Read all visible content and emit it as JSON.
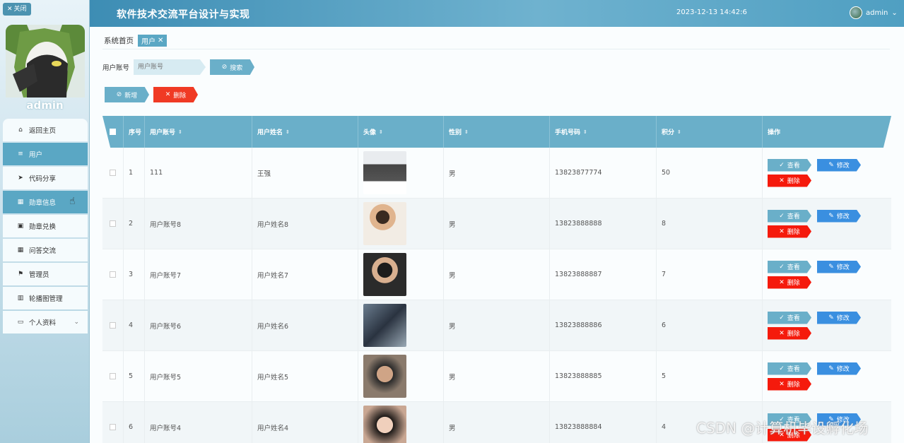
{
  "app": {
    "title": "软件技术交流平台设计与实现",
    "datetime": "2023-12-13 14:42:6",
    "user": "admin",
    "close_label": "关闭"
  },
  "sidebar": {
    "profile_name": "admin",
    "items": [
      {
        "label": "返回主页",
        "icon": "home-icon"
      },
      {
        "label": "用户",
        "icon": "list-icon"
      },
      {
        "label": "代码分享",
        "icon": "send-icon"
      },
      {
        "label": "勋章信息",
        "icon": "grid-icon"
      },
      {
        "label": "勋章兑换",
        "icon": "clipboard-icon"
      },
      {
        "label": "问答交流",
        "icon": "grid-icon"
      },
      {
        "label": "管理员",
        "icon": "flag-icon"
      },
      {
        "label": "轮播图管理",
        "icon": "chart-icon"
      },
      {
        "label": "个人资料",
        "icon": "window-icon"
      }
    ]
  },
  "breadcrumb": {
    "home": "系统首页",
    "current": "用户"
  },
  "search": {
    "label": "用户账号",
    "placeholder": "用户账号",
    "button": "搜索"
  },
  "actions": {
    "add": "新增",
    "delete": "删除"
  },
  "table": {
    "headers": [
      "序号",
      "用户账号",
      "用户姓名",
      "头像",
      "性别",
      "手机号码",
      "积分",
      "操作"
    ],
    "row_actions": {
      "view": "查看",
      "edit": "修改",
      "delete": "删除"
    },
    "rows": [
      {
        "index": "1",
        "account": "111",
        "name": "王强",
        "gender": "男",
        "phone": "13823877774",
        "points": "50"
      },
      {
        "index": "2",
        "account": "用户账号8",
        "name": "用户姓名8",
        "gender": "男",
        "phone": "13823888888",
        "points": "8"
      },
      {
        "index": "3",
        "account": "用户账号7",
        "name": "用户姓名7",
        "gender": "男",
        "phone": "13823888887",
        "points": "7"
      },
      {
        "index": "4",
        "account": "用户账号6",
        "name": "用户姓名6",
        "gender": "男",
        "phone": "13823888886",
        "points": "6"
      },
      {
        "index": "5",
        "account": "用户账号5",
        "name": "用户姓名5",
        "gender": "男",
        "phone": "13823888885",
        "points": "5"
      },
      {
        "index": "6",
        "account": "用户账号4",
        "name": "用户姓名4",
        "gender": "男",
        "phone": "13823888884",
        "points": "4"
      }
    ]
  },
  "watermark": "CSDN @计算机毕设孵化场",
  "colors": {
    "accent": "#5aa7c4",
    "danger": "#f03a24",
    "edit": "#3a8fe0"
  }
}
